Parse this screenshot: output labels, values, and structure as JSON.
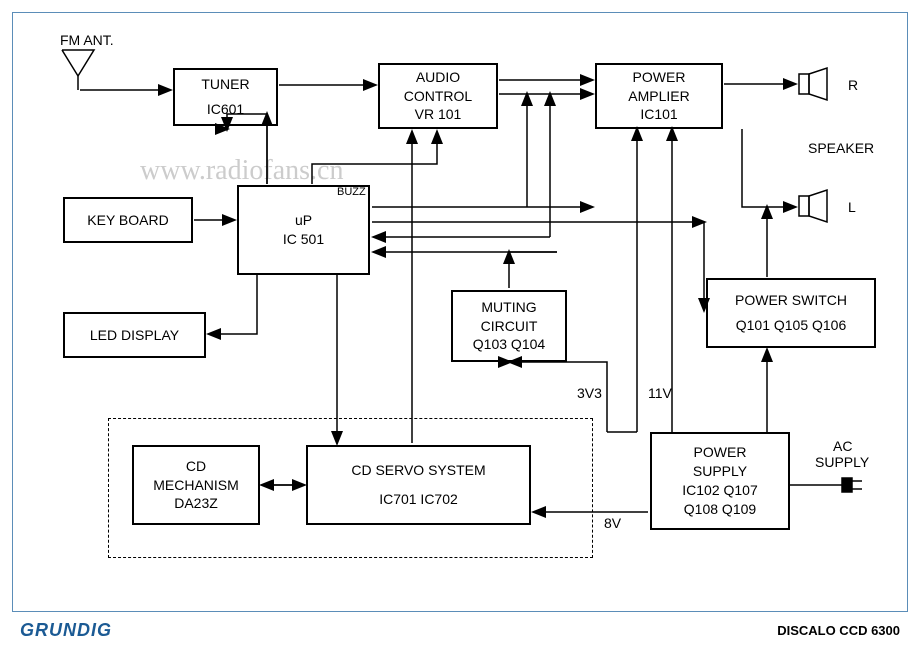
{
  "header": {
    "fm_ant": "FM ANT."
  },
  "blocks": {
    "tuner": {
      "line1": "TUNER",
      "line2": "IC601"
    },
    "audio_control": {
      "line1": "AUDIO",
      "line2": "CONTROL",
      "line3": "VR 101"
    },
    "power_amp": {
      "line1": "POWER",
      "line2": "AMPLIER",
      "line3": "IC101"
    },
    "keyboard": {
      "line1": "KEY   BOARD"
    },
    "up": {
      "line1": "uP",
      "line2": "IC 501"
    },
    "muting": {
      "line1": "MUTING",
      "line2": "CIRCUIT",
      "line3": "Q103   Q104"
    },
    "power_switch": {
      "line1": "POWER   SWITCH",
      "line2": "Q101 Q105 Q106"
    },
    "led": {
      "line1": "LED   DISPLAY"
    },
    "cd_mech": {
      "line1": "CD",
      "line2": "MECHANISM",
      "line3": "DA23Z"
    },
    "cd_servo": {
      "line1": "CD   SERVO   SYSTEM",
      "line2": "IC701   IC702"
    },
    "power_supply": {
      "line1": "POWER",
      "line2": "SUPPLY",
      "line3": "IC102   Q107",
      "line4": "Q108   Q109"
    }
  },
  "labels": {
    "buzz": "BUZZ",
    "r": "R",
    "l": "L",
    "speaker": "SPEAKER",
    "v3v3": "3V3",
    "v11": "11V",
    "v8": "8V",
    "ac_supply1": "AC",
    "ac_supply2": "SUPPLY"
  },
  "footer": {
    "brand": "GRUNDIG",
    "model": "DISCALO CCD 6300"
  },
  "watermark": "www.radiofans.cn"
}
